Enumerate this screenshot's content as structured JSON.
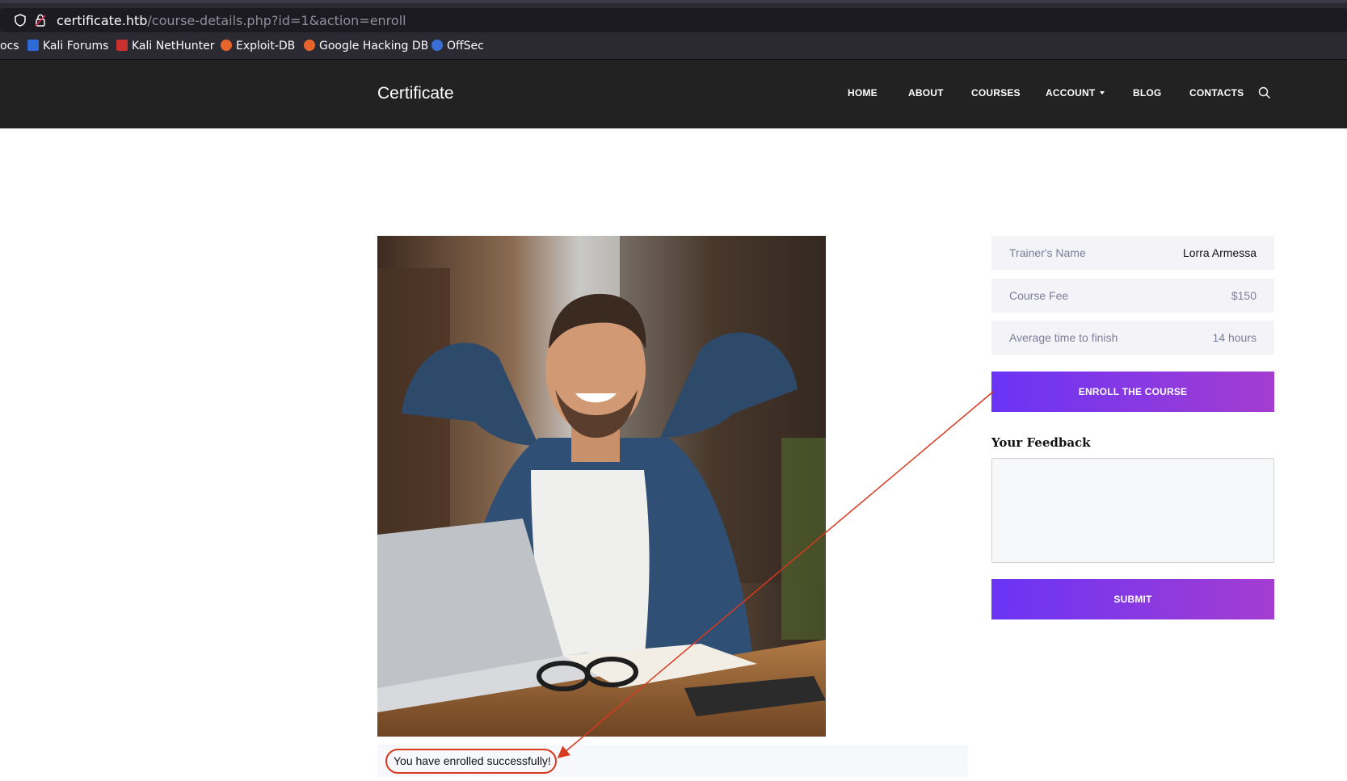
{
  "browser": {
    "url_host": "certificate.htb",
    "url_path": "/course-details.php?id=1&action=enroll",
    "bookmarks": [
      {
        "label": "ocs",
        "icon": "none"
      },
      {
        "label": "Kali Forums",
        "icon": "kali-forums-icon"
      },
      {
        "label": "Kali NetHunter",
        "icon": "nethunter-icon"
      },
      {
        "label": "Exploit-DB",
        "icon": "exploit-db-icon"
      },
      {
        "label": "Google Hacking DB",
        "icon": "ghdb-icon"
      },
      {
        "label": "OffSec",
        "icon": "offsec-icon"
      }
    ]
  },
  "header": {
    "brand": "Certificate",
    "nav": [
      "HOME",
      "ABOUT",
      "COURSES",
      "ACCOUNT",
      "BLOG",
      "CONTACTS"
    ]
  },
  "main": {
    "photo_alt": "man relaxing at desk with laptop",
    "success_message": "You have enrolled successfully!"
  },
  "sidebar": {
    "info": [
      {
        "label": "Trainer's Name",
        "value": "Lorra Armessa"
      },
      {
        "label": "Course Fee",
        "value": "$150"
      },
      {
        "label": "Average time to finish",
        "value": "14 hours"
      }
    ],
    "enroll_label": "ENROLL THE COURSE",
    "feedback_title": "Your Feedback",
    "submit_label": "SUBMIT"
  },
  "colors": {
    "header_bg": "#222222",
    "button_gradient_start": "#6a34f5",
    "button_gradient_end": "#a43dd0",
    "annotation": "#d9391f"
  }
}
